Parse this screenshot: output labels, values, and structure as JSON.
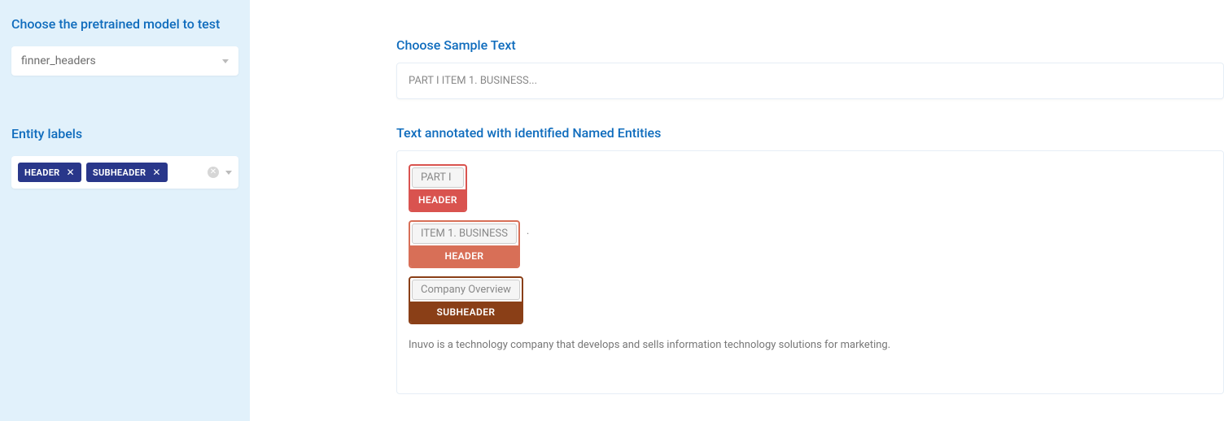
{
  "sidebar": {
    "model_heading": "Choose the pretrained model to test",
    "model_value": "finner_headers",
    "labels_heading": "Entity labels",
    "labels": [
      {
        "name": "HEADER"
      },
      {
        "name": "SUBHEADER"
      }
    ]
  },
  "main": {
    "sample_heading": "Choose Sample Text",
    "sample_value": "PART I ITEM 1. BUSINESS...",
    "annot_heading": "Text annotated with identified Named Entities",
    "entities": [
      {
        "text": "PART I",
        "label": "HEADER",
        "style": "header1",
        "trailing": ""
      },
      {
        "text": "ITEM 1. BUSINESS",
        "label": "HEADER",
        "style": "header2",
        "trailing": "."
      },
      {
        "text": "Company Overview",
        "label": "SUBHEADER",
        "style": "subheader",
        "trailing": ""
      }
    ],
    "body_text": "Inuvo is a technology company that develops and sells information technology solutions for marketing."
  }
}
